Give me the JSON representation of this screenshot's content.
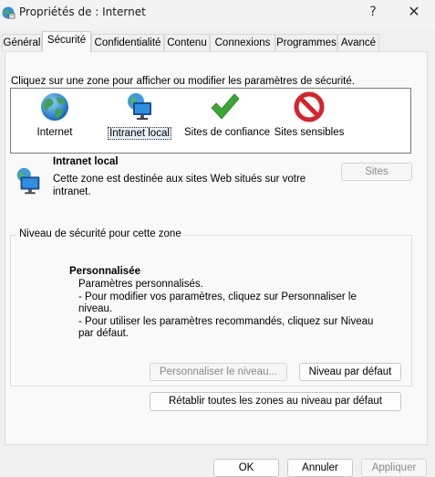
{
  "window": {
    "title": "Propriétés de : Internet",
    "help": "?",
    "close": "✕"
  },
  "tabs": [
    {
      "label": "Général"
    },
    {
      "label": "Sécurité"
    },
    {
      "label": "Confidentialité"
    },
    {
      "label": "Contenu"
    },
    {
      "label": "Connexions"
    },
    {
      "label": "Programmes"
    },
    {
      "label": "Avancé"
    }
  ],
  "active_tab": "Sécurité",
  "security": {
    "instruction": "Cliquez sur une zone pour afficher ou modifier les paramètres de sécurité.",
    "zones": [
      {
        "label": "Internet",
        "icon": "globe-icon"
      },
      {
        "label": "Intranet local",
        "icon": "network-monitor-icon"
      },
      {
        "label": "Sites de confiance",
        "icon": "checkmark-icon"
      },
      {
        "label": "Sites sensibles",
        "icon": "prohibited-icon"
      }
    ],
    "selected_zone": "Intranet local",
    "zone_detail": {
      "title": "Intranet local",
      "description": "Cette zone est destinée aux sites Web situés sur votre intranet.",
      "sites_button": "Sites"
    },
    "level_group": {
      "label": "Niveau de sécurité pour cette zone",
      "title": "Personnalisée",
      "lines": [
        "Paramètres personnalisés.",
        "- Pour modifier vos paramètres, cliquez sur Personnaliser le niveau.",
        "- Pour utiliser les paramètres recommandés, cliquez sur Niveau par défaut."
      ],
      "custom_level_button": "Personnaliser le niveau...",
      "default_level_button": "Niveau par défaut"
    },
    "reset_all_button": "Rétablir toutes les zones au niveau par défaut"
  },
  "footer": {
    "ok": "OK",
    "cancel": "Annuler",
    "apply": "Appliquer"
  },
  "colors": {
    "accent": "#0067c0",
    "selected_bg": "#e5f1fb",
    "check_green": "#3aa635",
    "prohibited_red": "#d8232a"
  }
}
